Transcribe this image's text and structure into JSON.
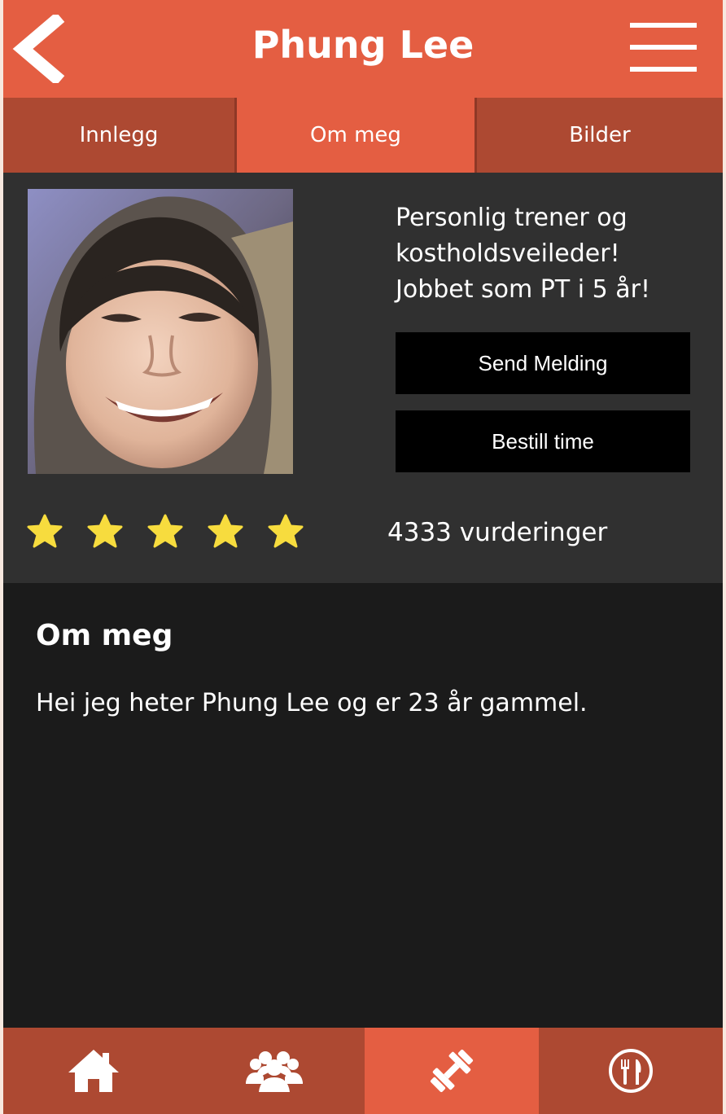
{
  "header": {
    "title": "Phung Lee",
    "back_icon": "chevron-left-icon",
    "menu_icon": "hamburger-menu-icon"
  },
  "tabs": [
    {
      "label": "Innlegg",
      "active": false
    },
    {
      "label": "Om meg",
      "active": true
    },
    {
      "label": "Bilder",
      "active": false
    }
  ],
  "profile": {
    "bio_lines": [
      "Personlig trener og",
      "kostholdsveileder!",
      "Jobbet som PT i 5 år!"
    ],
    "send_message_label": "Send Melding",
    "book_label": "Bestill time",
    "rating_stars": 5,
    "rating_max": 5,
    "ratings_count": "4333 vurderinger"
  },
  "about": {
    "heading": "Om meg",
    "text": "Hei jeg heter Phung Lee og er 23 år gammel."
  },
  "bottom_nav": [
    {
      "icon": "home-icon",
      "active": false
    },
    {
      "icon": "group-icon",
      "active": false
    },
    {
      "icon": "dumbbell-icon",
      "active": true
    },
    {
      "icon": "restaurant-icon",
      "active": false
    }
  ],
  "colors": {
    "accent": "#e45e42",
    "accent_dark": "#ad4932",
    "panel": "#303030",
    "background": "#1b1b1b",
    "star": "#f7dc3e"
  }
}
